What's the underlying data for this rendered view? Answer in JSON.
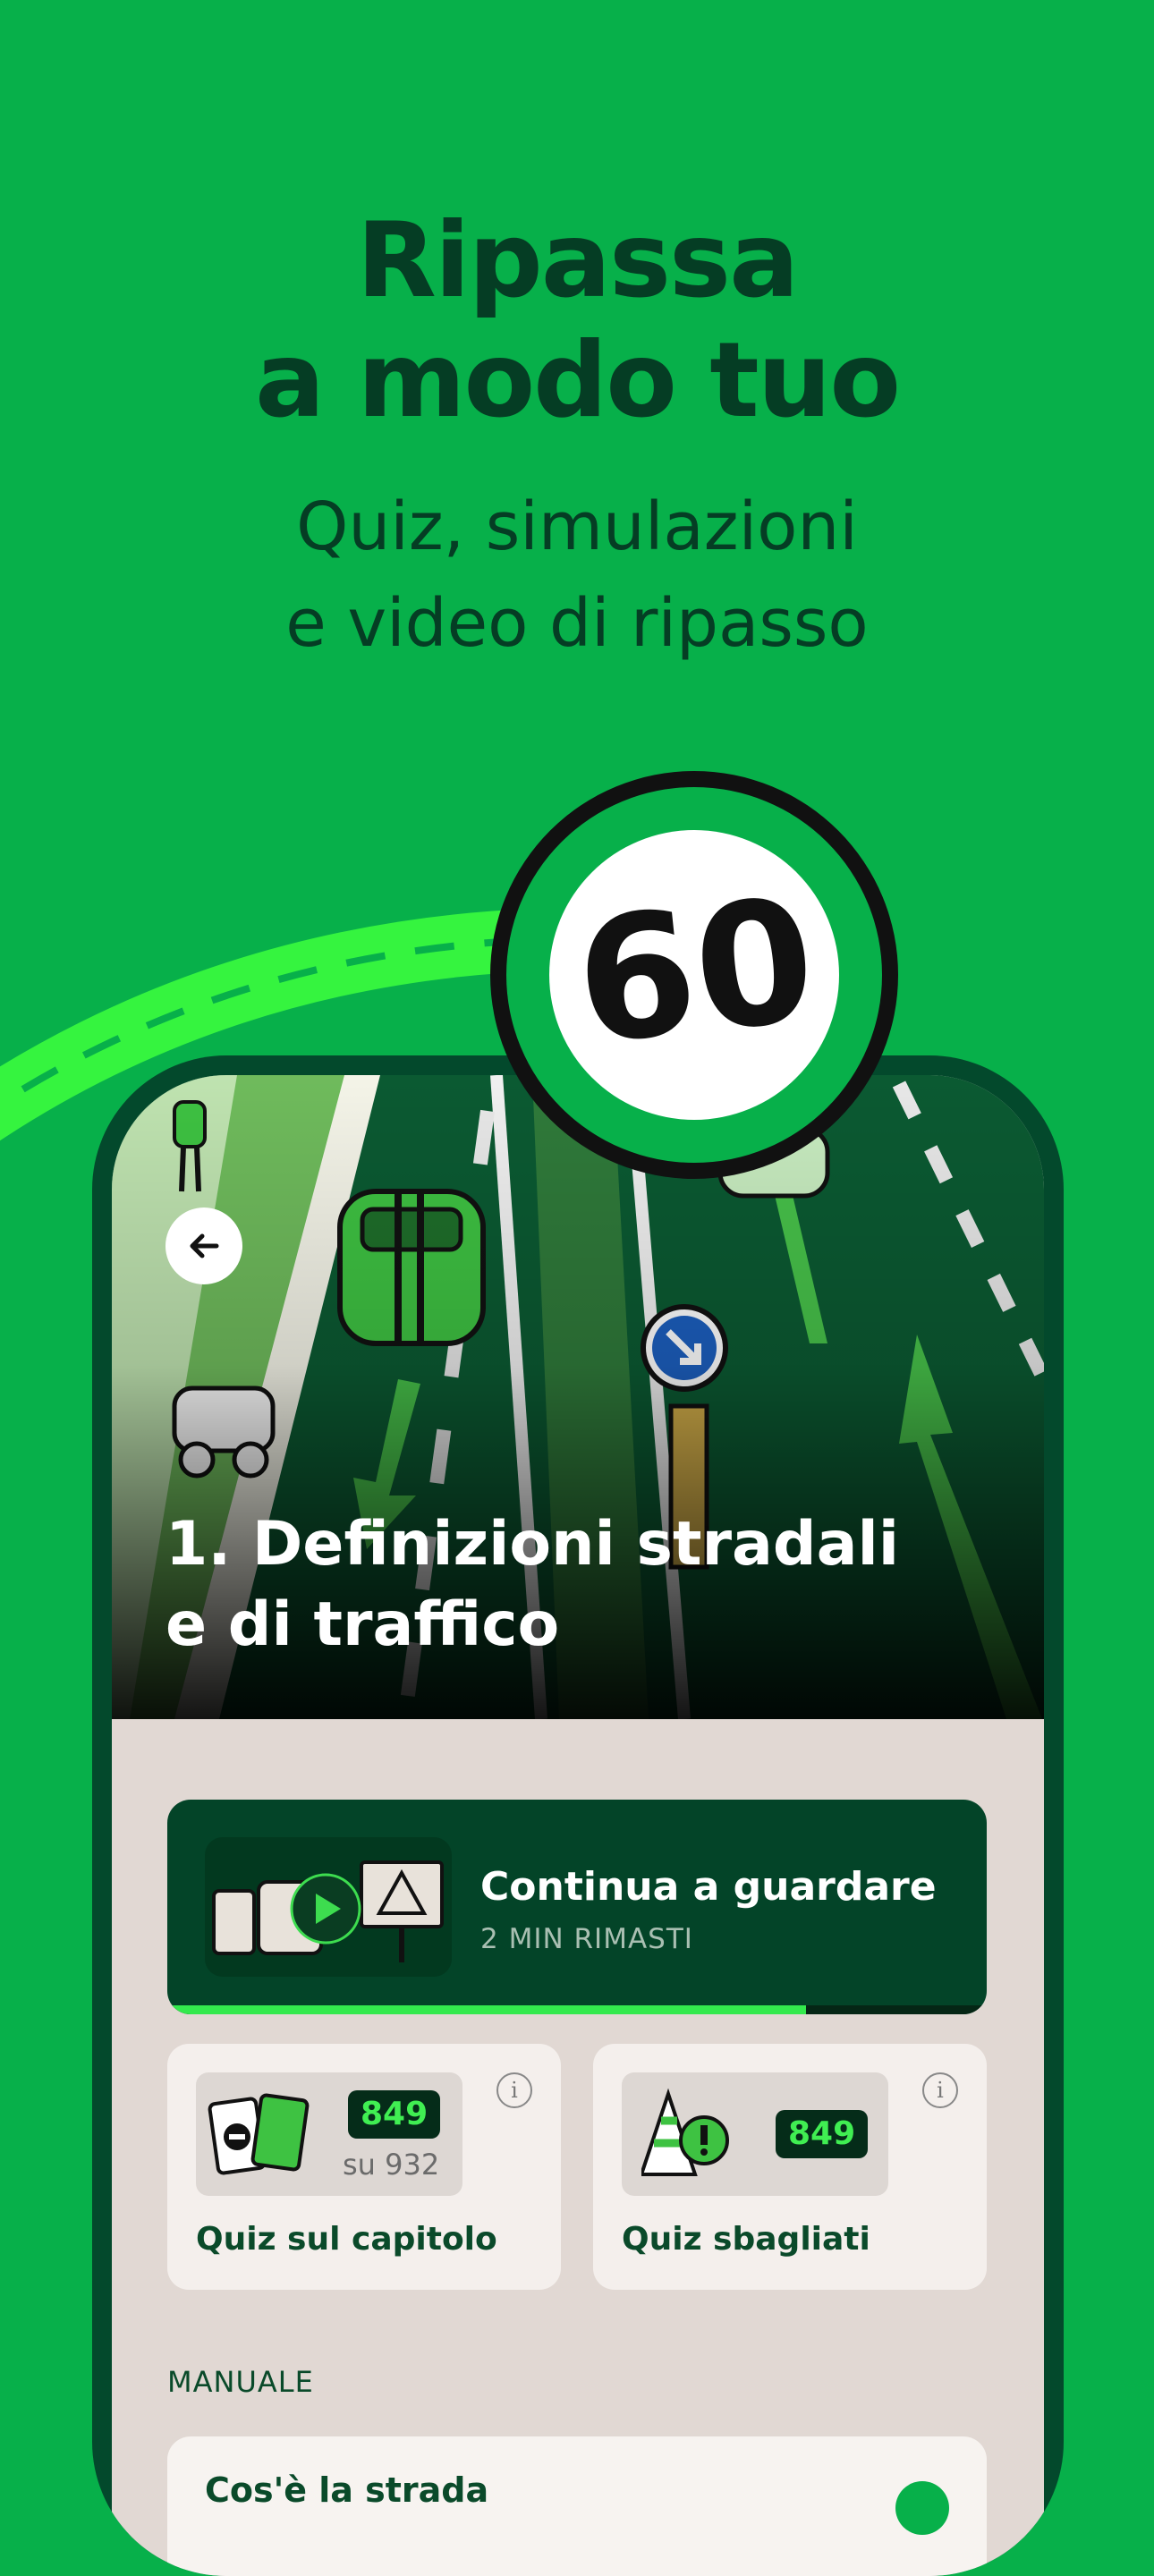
{
  "headline": {
    "line1": "Ripassa",
    "line2": "a modo tuo"
  },
  "subheadline": {
    "line1": "Quiz, simulazioni",
    "line2": "e video di ripasso"
  },
  "speed_sign": {
    "value": "60"
  },
  "chapter": {
    "title_line1": "1. Definizioni stradali",
    "title_line2": "e di traffico"
  },
  "continue_watching": {
    "title": "Continua a guardare",
    "subtitle": "2 MIN RIMASTI",
    "progress": 0.78
  },
  "quiz_chapter": {
    "count": "849",
    "total": "su 932",
    "label": "Quiz sul capitolo"
  },
  "quiz_wrong": {
    "count": "849",
    "label": "Quiz sbagliati"
  },
  "manual": {
    "section_label": "MANUALE",
    "first_item": "Cos'è la strada"
  },
  "colors": {
    "background": "#07b04a",
    "dark_green": "#053d24",
    "accent": "#33e94d"
  },
  "icons": [
    "arrow-left-icon",
    "play-icon",
    "info-icon",
    "warning-cone-icon",
    "quiz-cards-icon",
    "check-icon"
  ]
}
